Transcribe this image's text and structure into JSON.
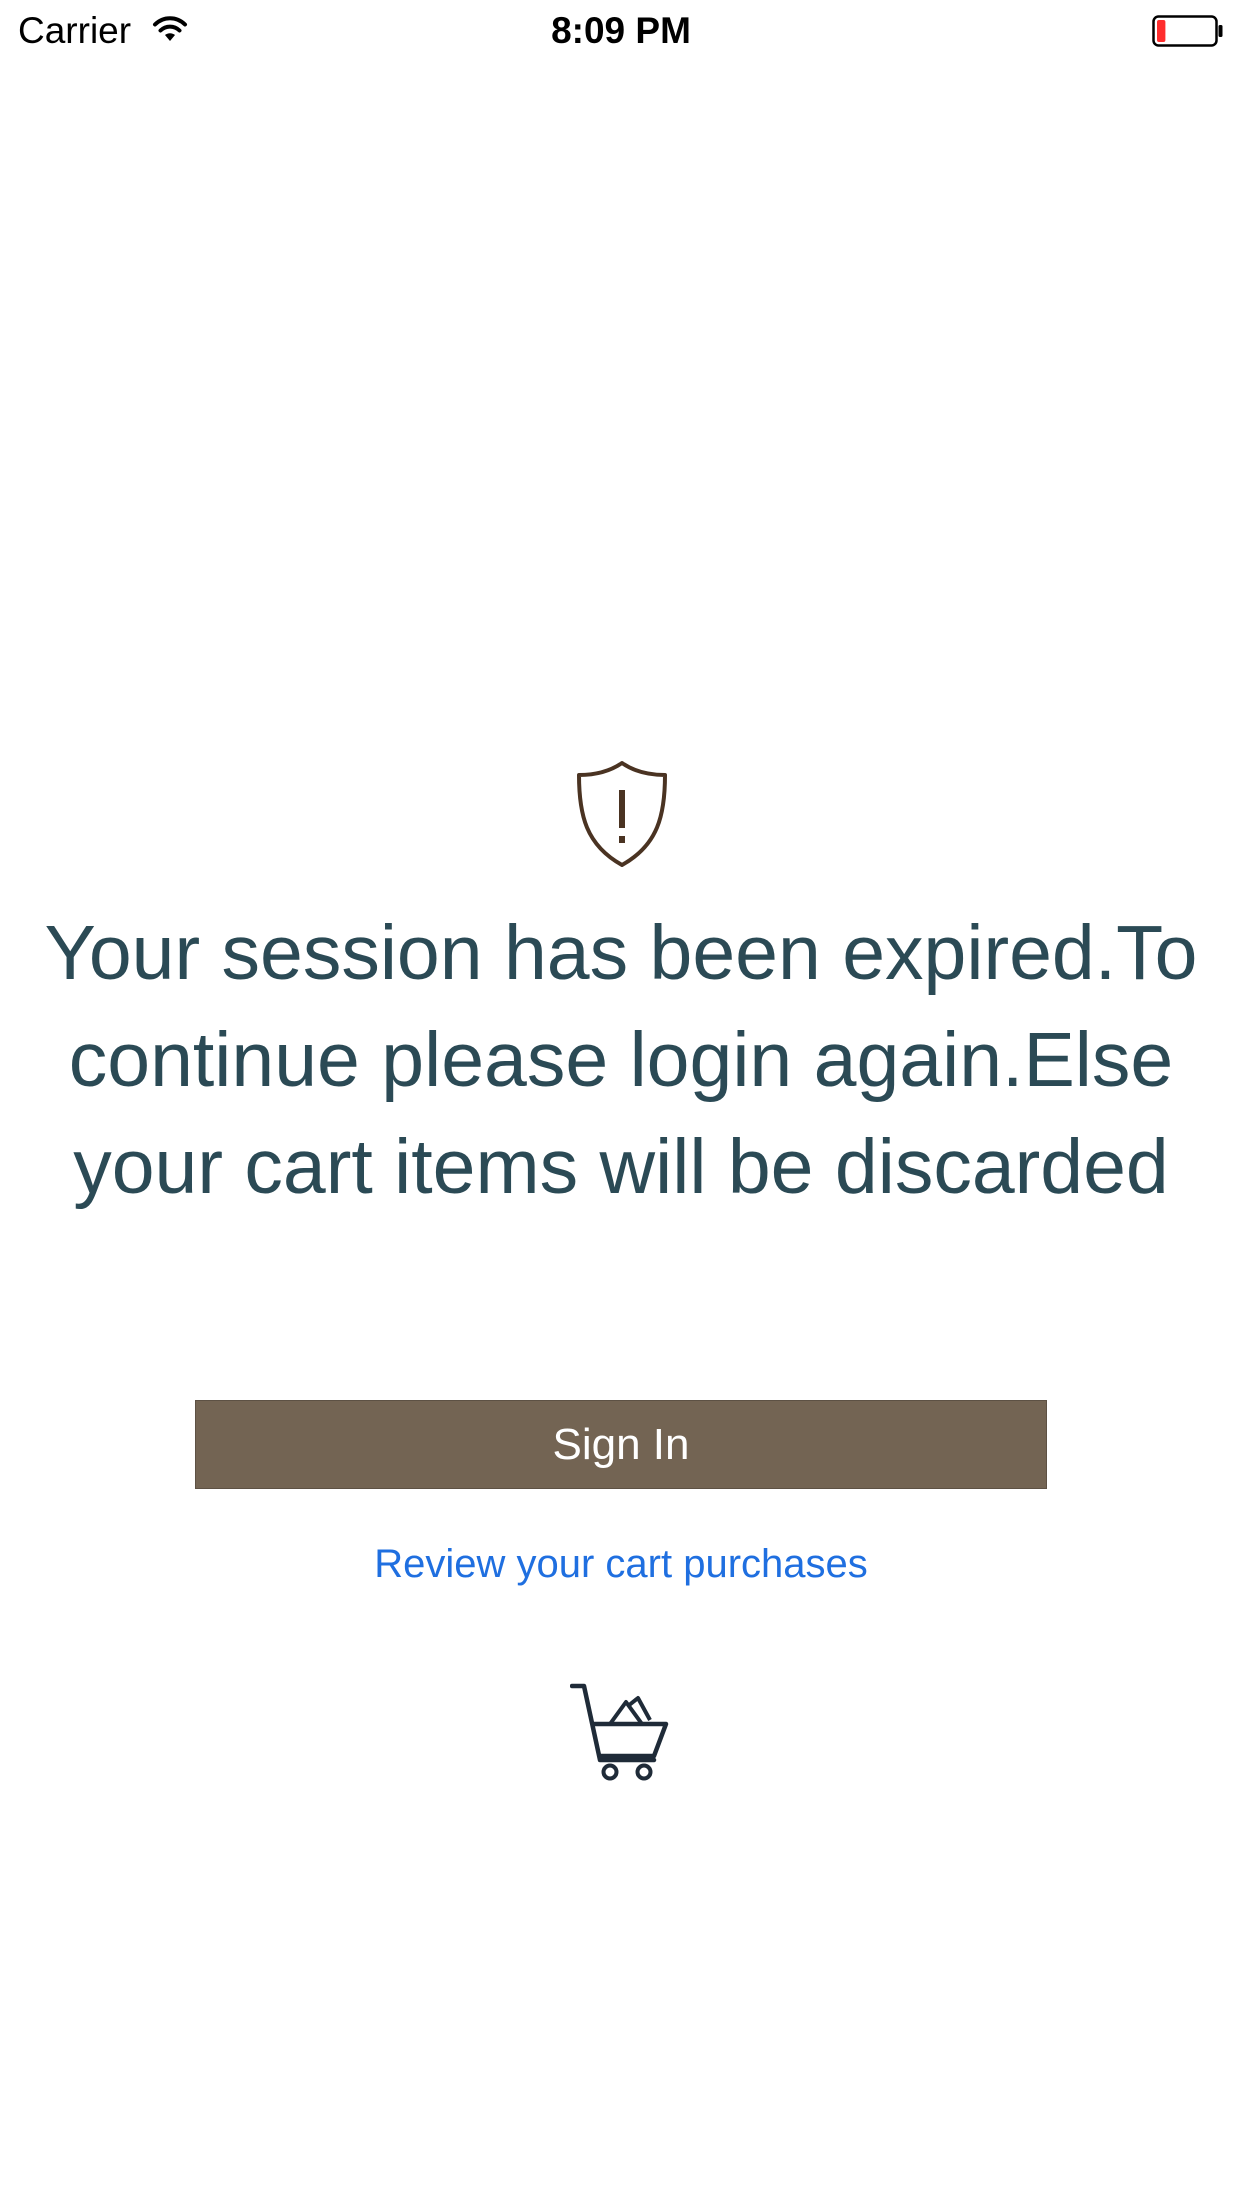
{
  "status_bar": {
    "carrier": "Carrier",
    "time": "8:09 PM",
    "battery_level": 0.15,
    "battery_color": "#ff2d2d",
    "wifi_icon": "wifi-icon",
    "battery_icon": "battery-icon"
  },
  "alert": {
    "icon": "shield-warning-icon",
    "icon_color": "#4a3322",
    "message": "Your session has been expired.To continue please login again.Else your cart items will be discarded",
    "message_color": "#2b4a55"
  },
  "actions": {
    "sign_in_label": "Sign In",
    "sign_in_color": "#736453",
    "review_label": "Review your cart purchases",
    "review_color": "#1f6fe0",
    "cart_icon": "shopping-cart-icon"
  }
}
